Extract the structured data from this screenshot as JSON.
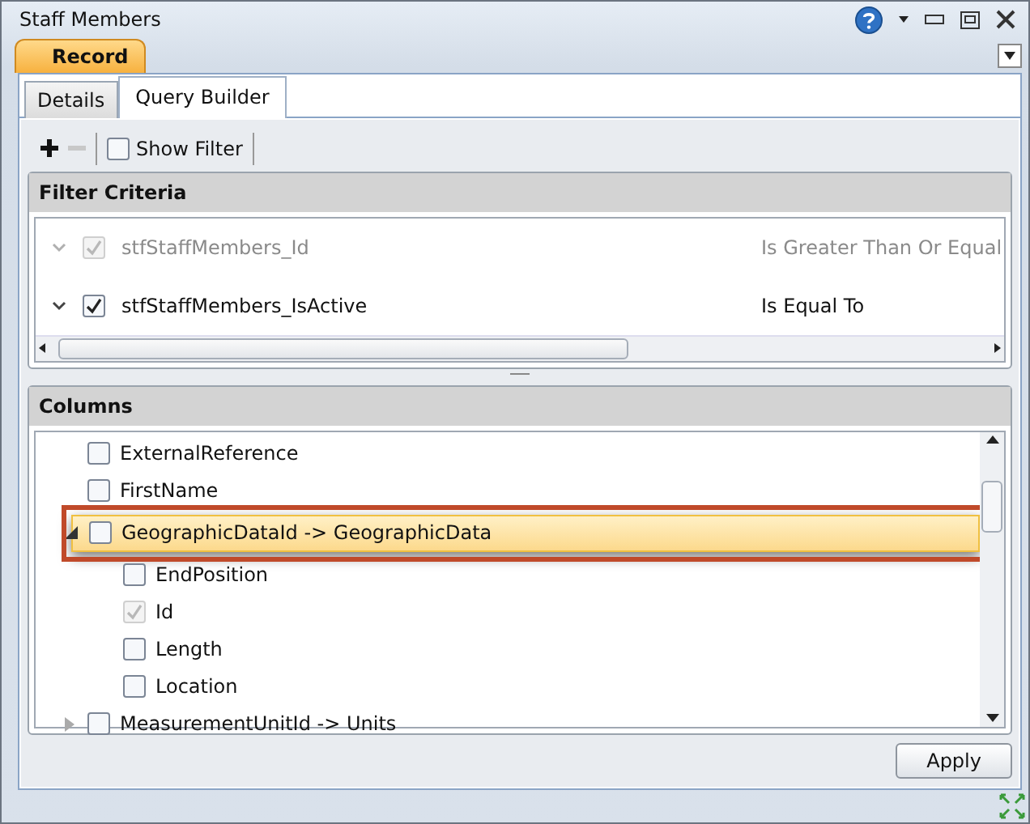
{
  "window": {
    "title": "Staff Members"
  },
  "record_tab": {
    "label": "Record"
  },
  "tabs": [
    {
      "label": "Details",
      "selected": false
    },
    {
      "label": "Query Builder",
      "selected": true
    }
  ],
  "toolbar": {
    "show_filter": {
      "label": "Show Filter",
      "checked": false
    },
    "remove_disabled": true
  },
  "filter_criteria": {
    "title": "Filter Criteria",
    "rows": [
      {
        "field": "stfStaffMembers_Id",
        "operator": "Is Greater Than Or Equal",
        "checked": true,
        "disabled": true
      },
      {
        "field": "stfStaffMembers_IsActive",
        "operator": "Is Equal To",
        "checked": true,
        "disabled": false
      }
    ]
  },
  "columns": {
    "title": "Columns",
    "items": [
      {
        "label": "ExternalReference",
        "checked": false,
        "disabled": false,
        "selected": false
      },
      {
        "label": "FirstName",
        "checked": false,
        "disabled": false,
        "selected": false
      },
      {
        "label": "GeographicDataId -> GeographicData",
        "checked": false,
        "disabled": false,
        "selected": true,
        "expanded": true,
        "children": [
          {
            "label": "EndPosition",
            "checked": false,
            "disabled": false,
            "selected": false
          },
          {
            "label": "Id",
            "checked": true,
            "disabled": true,
            "selected": false
          },
          {
            "label": "Length",
            "checked": false,
            "disabled": false,
            "selected": false
          },
          {
            "label": "Location",
            "checked": false,
            "disabled": false,
            "selected": false
          }
        ]
      },
      {
        "label": "MeasurementUnitId -> Units",
        "checked": false,
        "disabled": false,
        "selected": false,
        "expanded": false
      }
    ]
  },
  "buttons": [
    {
      "label": "Apply"
    }
  ]
}
